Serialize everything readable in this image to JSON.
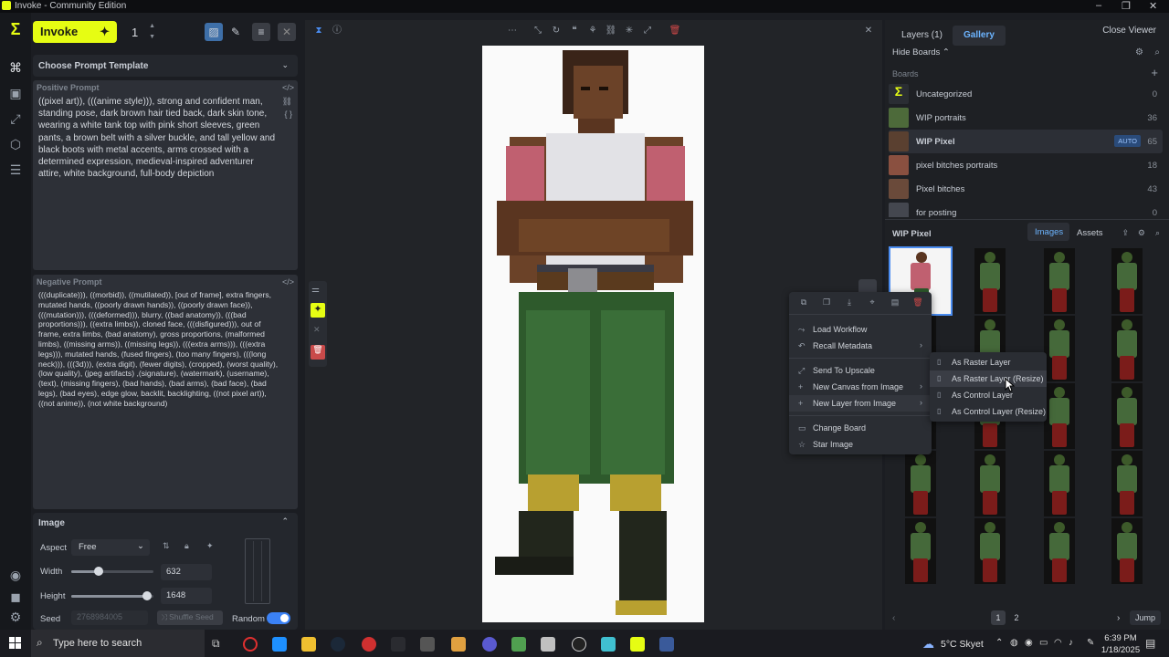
{
  "window": {
    "title": "Invoke - Community Edition"
  },
  "toolbar": {
    "invoke_label": "Invoke",
    "count": "1"
  },
  "prompt_template": {
    "label": "Choose Prompt Template"
  },
  "positive": {
    "label": "Positive Prompt",
    "text": "((pixel art)), (((anime style))), strong and confident man, standing pose, dark brown hair tied back, dark skin tone, wearing a white tank top with pink short sleeves, green pants, a brown belt with a silver buckle, and tall yellow and black boots with metal accents, arms crossed with a determined expression, medieval-inspired adventurer attire, white background, full-body depiction"
  },
  "negative": {
    "label": "Negative Prompt",
    "text": "(((duplicate))), ((morbid)), ((mutilated)), [out of frame], extra fingers, mutated hands, ((poorly drawn hands)), ((poorly drawn face)), (((mutation))), (((deformed))), blurry, ((bad anatomy)), (((bad proportions))), ((extra limbs)), cloned face, (((disfigured))), out of frame, extra limbs, (bad anatomy), gross proportions, (malformed limbs), ((missing arms)), ((missing legs)), (((extra arms))), (((extra legs))), mutated hands, (fused fingers), (too many fingers), (((long neck))), (((3d))), (extra digit), (fewer digits), (cropped), (worst quality), (low quality), (jpeg artifacts) ,(signature), (watermark), (username),(text), (missing fingers), (bad hands), (bad arms),  (bad face),  (bad legs), (bad eyes), edge glow, backlit, backlighting, ((not pixel art)), ((not anime)), (not white background)"
  },
  "image_section": {
    "label": "Image",
    "aspect_label": "Aspect",
    "aspect_value": "Free",
    "width_label": "Width",
    "width_value": "632",
    "height_label": "Height",
    "height_value": "1648",
    "seed_label": "Seed",
    "seed_value": "2768984005",
    "shuffle_label": "Shuffle Seed",
    "random_label": "Random",
    "width_slider_fraction": 0.33,
    "height_slider_fraction": 0.92
  },
  "right": {
    "tab_layers": "Layers (1)",
    "tab_gallery": "Gallery",
    "close_viewer": "Close Viewer",
    "hide_boards": "Hide Boards",
    "boards_label": "Boards",
    "boards": [
      {
        "name": "Uncategorized",
        "count": "0"
      },
      {
        "name": "WIP portraits",
        "count": "36"
      },
      {
        "name": "WIP Pixel",
        "count": "65",
        "badge": "AUTO"
      },
      {
        "name": "pixel bitches portraits",
        "count": "18"
      },
      {
        "name": "Pixel bitches",
        "count": "43"
      },
      {
        "name": "for posting",
        "count": "0"
      }
    ],
    "current_board": "WIP Pixel",
    "tab_images": "Images",
    "tab_assets": "Assets",
    "pages": [
      "1",
      "2"
    ],
    "jump": "Jump"
  },
  "context_menu": {
    "items": [
      {
        "label": "Load Workflow",
        "icon": "workflow-icon"
      },
      {
        "label": "Recall Metadata",
        "icon": "recall-icon",
        "submenu": true
      },
      {
        "label": "Send To Upscale",
        "icon": "upscale-icon"
      },
      {
        "label": "New Canvas from Image",
        "icon": "plus-icon",
        "submenu": true
      },
      {
        "label": "New Layer from Image",
        "icon": "plus-icon",
        "submenu": true
      },
      {
        "label": "Change Board",
        "icon": "board-icon"
      },
      {
        "label": "Star Image",
        "icon": "star-icon"
      }
    ]
  },
  "submenu": {
    "items": [
      {
        "label": "As Raster Layer"
      },
      {
        "label": "As Raster Layer (Resize)"
      },
      {
        "label": "As Control Layer"
      },
      {
        "label": "As Control Layer (Resize)"
      }
    ]
  },
  "taskbar": {
    "search_placeholder": "Type here to search",
    "weather": "5°C  Skyet",
    "time": "6:39 PM",
    "date": "1/18/2025"
  },
  "colors": {
    "accent": "#e6fd13",
    "selection": "#4a8cf0",
    "toggle": "#3b82f6"
  }
}
